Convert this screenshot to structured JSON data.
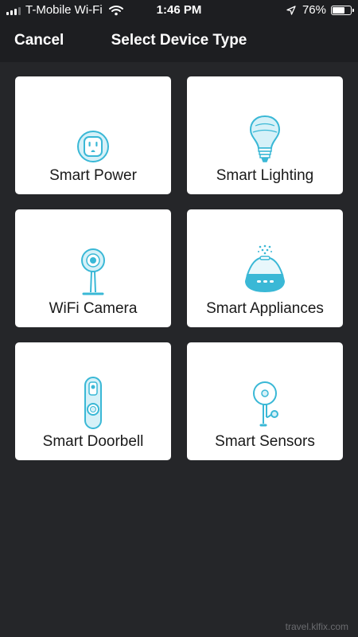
{
  "status_bar": {
    "carrier": "T-Mobile Wi-Fi",
    "time": "1:46 PM",
    "battery_percent": "76%",
    "battery_level": 0.76
  },
  "nav": {
    "cancel_label": "Cancel",
    "title": "Select Device Type"
  },
  "devices": [
    {
      "label": "Smart Power",
      "icon": "outlet-icon"
    },
    {
      "label": "Smart Lighting",
      "icon": "light-bulb-icon"
    },
    {
      "label": "WiFi Camera",
      "icon": "camera-icon"
    },
    {
      "label": "Smart Appliances",
      "icon": "diffuser-icon"
    },
    {
      "label": "Smart Doorbell",
      "icon": "doorbell-icon"
    },
    {
      "label": "Smart Sensors",
      "icon": "sensor-icon"
    }
  ],
  "watermark": "travel.klfix.com",
  "colors": {
    "background": "#252629",
    "bar": "#1d1e21",
    "card": "#ffffff",
    "icon_accent": "#3ab8d6"
  }
}
